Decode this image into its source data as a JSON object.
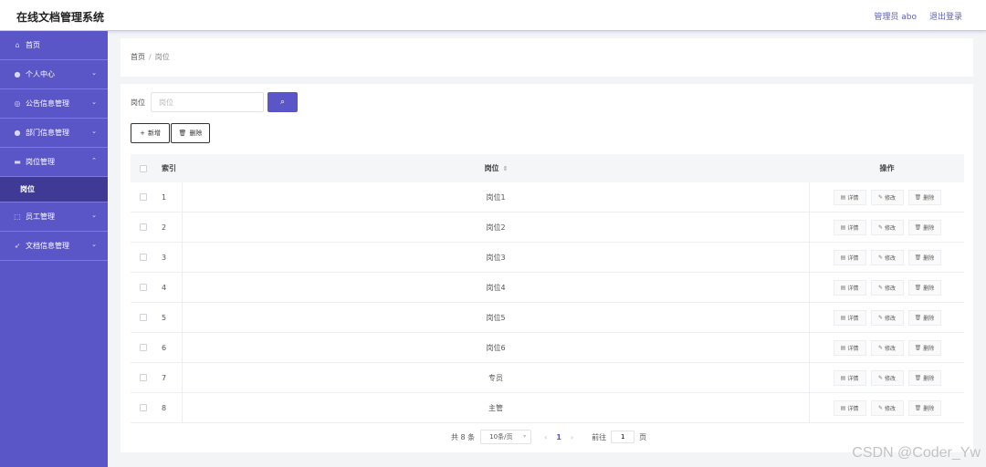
{
  "header": {
    "app_title": "在线文档管理系统",
    "user_label": "管理员 abo",
    "logout_label": "退出登录"
  },
  "sidebar": {
    "items": [
      {
        "label": "首页",
        "icon": "home-icon",
        "chevron": ""
      },
      {
        "label": "个人中心",
        "icon": "user-icon",
        "chevron": "⌄"
      },
      {
        "label": "公告信息管理",
        "icon": "globe-icon",
        "chevron": "⌄"
      },
      {
        "label": "部门信息管理",
        "icon": "user-icon",
        "chevron": "⌄"
      },
      {
        "label": "岗位管理",
        "icon": "briefcase-icon",
        "chevron": "⌃"
      },
      {
        "label": "员工管理",
        "icon": "dashed-box-icon",
        "chevron": "⌄"
      },
      {
        "label": "文档信息管理",
        "icon": "send-icon",
        "chevron": "⌄"
      }
    ],
    "active_sub": "岗位"
  },
  "breadcrumb": {
    "home": "首页",
    "separator": "/",
    "current": "岗位"
  },
  "search": {
    "label": "岗位",
    "placeholder": "岗位",
    "button_icon": "search-icon"
  },
  "toolbar": {
    "add_label": "新增",
    "delete_label": "删除"
  },
  "table": {
    "columns": {
      "index": "索引",
      "name": "岗位",
      "ops": "操作"
    },
    "row_actions": {
      "detail": "详情",
      "edit": "修改",
      "delete": "删除"
    },
    "rows": [
      {
        "index": "1",
        "name": "岗位1"
      },
      {
        "index": "2",
        "name": "岗位2"
      },
      {
        "index": "3",
        "name": "岗位3"
      },
      {
        "index": "4",
        "name": "岗位4"
      },
      {
        "index": "5",
        "name": "岗位5"
      },
      {
        "index": "6",
        "name": "岗位6"
      },
      {
        "index": "7",
        "name": "专员"
      },
      {
        "index": "8",
        "name": "主管"
      }
    ]
  },
  "pagination": {
    "total": "共 8 条",
    "page_size": "10条/页",
    "current_page": "1",
    "goto_prefix": "前往",
    "goto_value": "1",
    "goto_suffix": "页"
  },
  "watermark": "CSDN @Coder_Yw",
  "colors": {
    "accent": "#5b56c8",
    "sidebar_active": "#3f3a95"
  }
}
